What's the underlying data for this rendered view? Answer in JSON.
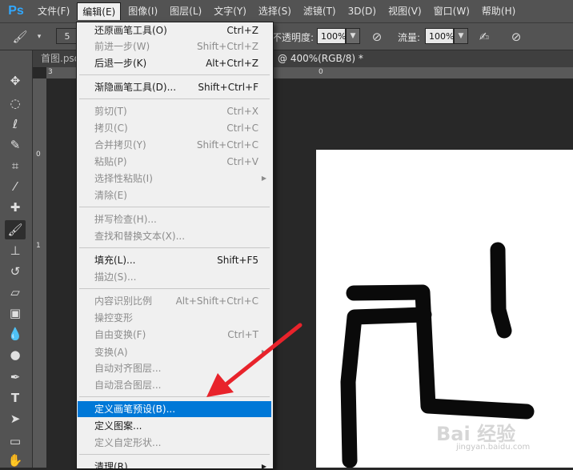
{
  "app": {
    "logo": "Ps"
  },
  "menubar": [
    "文件(F)",
    "编辑(E)",
    "图像(I)",
    "图层(L)",
    "文字(Y)",
    "选择(S)",
    "滤镜(T)",
    "3D(D)",
    "视图(V)",
    "窗口(W)",
    "帮助(H)"
  ],
  "options": {
    "brush_size": "5",
    "opacity_label": "不透明度:",
    "opacity_value": "100%",
    "flow_label": "流量:",
    "flow_value": "100%"
  },
  "tabs": {
    "doc1": "首图.psd",
    "doc2": "@ 400%(RGB/8) *"
  },
  "ruler": {
    "h1": "3",
    "h2": "0",
    "v1": "0",
    "v2": "1"
  },
  "edit_menu": {
    "undo": {
      "label": "还原画笔工具(O)",
      "shortcut": "Ctrl+Z"
    },
    "step_forward": {
      "label": "前进一步(W)",
      "shortcut": "Shift+Ctrl+Z"
    },
    "step_backward": {
      "label": "后退一步(K)",
      "shortcut": "Alt+Ctrl+Z"
    },
    "fade": {
      "label": "渐隐画笔工具(D)...",
      "shortcut": "Shift+Ctrl+F"
    },
    "cut": {
      "label": "剪切(T)",
      "shortcut": "Ctrl+X"
    },
    "copy": {
      "label": "拷贝(C)",
      "shortcut": "Ctrl+C"
    },
    "copy_merged": {
      "label": "合并拷贝(Y)",
      "shortcut": "Shift+Ctrl+C"
    },
    "paste": {
      "label": "粘贴(P)",
      "shortcut": "Ctrl+V"
    },
    "paste_special": {
      "label": "选择性粘贴(I)"
    },
    "clear": {
      "label": "清除(E)"
    },
    "spell_check": {
      "label": "拼写检查(H)..."
    },
    "find_replace": {
      "label": "查找和替换文本(X)..."
    },
    "fill": {
      "label": "填充(L)...",
      "shortcut": "Shift+F5"
    },
    "stroke": {
      "label": "描边(S)..."
    },
    "content_aware_scale": {
      "label": "内容识别比例",
      "shortcut": "Alt+Shift+Ctrl+C"
    },
    "puppet_warp": {
      "label": "操控变形"
    },
    "free_transform": {
      "label": "自由变换(F)",
      "shortcut": "Ctrl+T"
    },
    "transform": {
      "label": "变换(A)"
    },
    "auto_align": {
      "label": "自动对齐图层..."
    },
    "auto_blend": {
      "label": "自动混合图层..."
    },
    "define_brush": {
      "label": "定义画笔预设(B)..."
    },
    "define_pattern": {
      "label": "定义图案..."
    },
    "define_shape": {
      "label": "定义自定形状..."
    },
    "purge": {
      "label": "清理(R)"
    }
  },
  "watermark": {
    "brand": "Bai 经验",
    "url": "jingyan.baidu.com"
  },
  "colors": {
    "highlight": "#0078d7",
    "menu_bg": "#f0f0f0",
    "panel": "#535353",
    "arrow": "#e8232b"
  }
}
